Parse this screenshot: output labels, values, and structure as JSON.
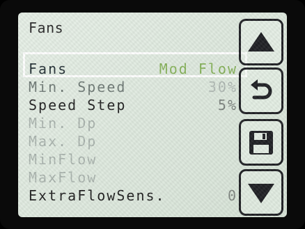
{
  "screen": {
    "title": "Fans",
    "menu": [
      {
        "label": "Fans",
        "value": "Mod Flow"
      },
      {
        "label": "Min. Speed",
        "value": "30%"
      },
      {
        "label": "Speed Step",
        "value": "5%"
      },
      {
        "label": "Min. Dp",
        "value": ""
      },
      {
        "label": "Max. Dp",
        "value": ""
      },
      {
        "label": "MinFlow",
        "value": ""
      },
      {
        "label": "MaxFlow",
        "value": ""
      },
      {
        "label": "ExtraFlowSens.",
        "value": "0"
      }
    ],
    "selected_index": 0,
    "buttons": [
      {
        "name": "up",
        "icon": "up-arrow-icon"
      },
      {
        "name": "back",
        "icon": "back-arrow-icon"
      },
      {
        "name": "save",
        "icon": "floppy-disk-icon"
      },
      {
        "name": "down",
        "icon": "down-arrow-icon"
      }
    ],
    "colors": {
      "selected_value": "#86b25a",
      "highlight_border": "#ffffff",
      "button_border": "#1f2024"
    }
  }
}
